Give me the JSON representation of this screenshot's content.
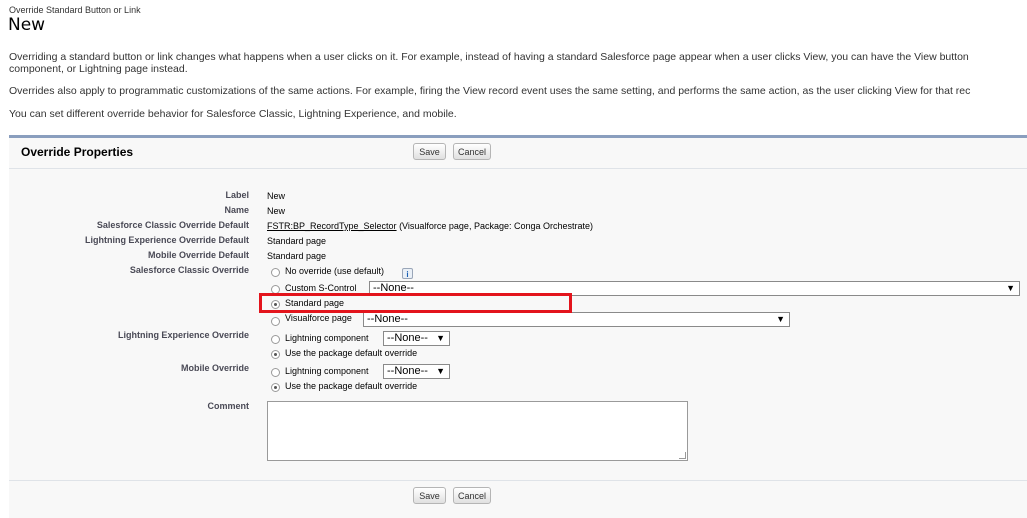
{
  "breadcrumb": "Override Standard Button or Link",
  "page_title": "New",
  "intro": {
    "line1": "Overriding a standard button or link changes what happens when a user clicks on it. For example, instead of having a standard Salesforce page appear when a user clicks View, you can have the View button",
    "line2": "component, or Lightning page instead.",
    "line3": "Overrides also apply to programmatic customizations of the same actions. For example, firing the View record event uses the same setting, and performs the same action, as the user clicking View for that rec",
    "line4": "You can set different override behavior for Salesforce Classic, Lightning Experience, and mobile."
  },
  "panel": {
    "title": "Override Properties",
    "save_label": "Save",
    "cancel_label": "Cancel"
  },
  "fields": {
    "label": {
      "label": "Label",
      "value": "New"
    },
    "name": {
      "label": "Name",
      "value": "New"
    },
    "classic_default": {
      "label": "Salesforce Classic Override Default",
      "link": "FSTR:BP_RecordType_Selector",
      "suffix": " (Visualforce page, Package: Conga Orchestrate)"
    },
    "lightning_default": {
      "label": "Lightning Experience Override Default",
      "value": "Standard page"
    },
    "mobile_default": {
      "label": "Mobile Override Default",
      "value": "Standard page"
    },
    "classic_override": {
      "label": "Salesforce Classic Override",
      "options": [
        "No override (use default)",
        "Custom S-Control",
        "Standard page",
        "Visualforce page"
      ],
      "scontrol_select": "--None--",
      "vf_select": "--None--",
      "selected": "Standard page"
    },
    "lightning_override": {
      "label": "Lightning Experience Override",
      "options": [
        "Lightning component",
        "Use the package default override"
      ],
      "component_select": "--None--",
      "selected": "Use the package default override"
    },
    "mobile_override": {
      "label": "Mobile Override",
      "options": [
        "Lightning component",
        "Use the package default override"
      ],
      "component_select": "--None--",
      "selected": "Use the package default override"
    },
    "comment": {
      "label": "Comment",
      "value": ""
    }
  },
  "icons": {
    "info": "info-icon",
    "dropdown": "chevron-down-icon"
  },
  "colors": {
    "highlight": "#e3141c",
    "panel_border": "#8a9ebe",
    "panel_bg": "#f8f8f8"
  }
}
